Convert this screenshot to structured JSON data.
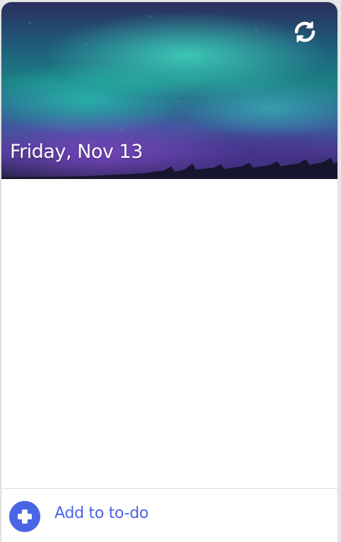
{
  "header": {
    "date_text": "Friday, Nov 13",
    "refresh_icon": "refresh-icon"
  },
  "footer": {
    "add_label": "Add to to-do",
    "add_icon": "plus-circle-icon"
  },
  "colors": {
    "accent": "#4a64e6",
    "date_text": "#ffffff",
    "footer_border": "#dedede"
  }
}
